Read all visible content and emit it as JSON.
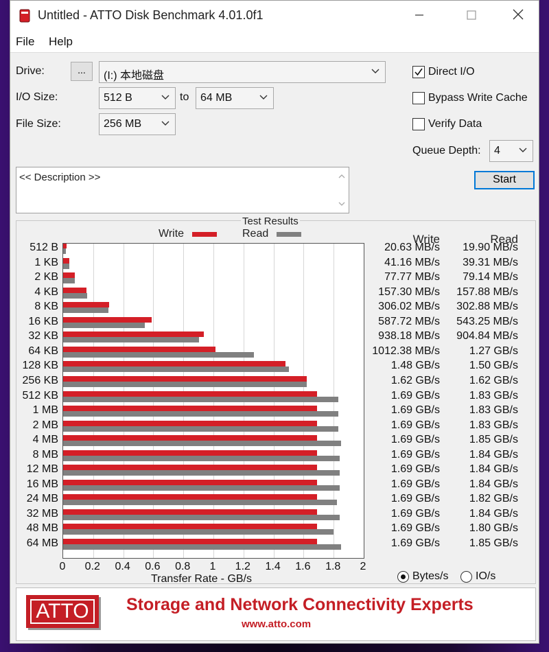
{
  "window": {
    "title": "Untitled - ATTO Disk Benchmark 4.01.0f1"
  },
  "menu": {
    "file": "File",
    "help": "Help"
  },
  "settings": {
    "drive_label": "Drive:",
    "browse_label": "...",
    "drive_value": "(I:) 本地磁盘",
    "io_size_label": "I/O Size:",
    "io_min": "512 B",
    "to_label": "to",
    "io_max": "64 MB",
    "file_size_label": "File Size:",
    "file_size": "256 MB",
    "direct_io_label": "Direct I/O",
    "direct_io_checked": true,
    "bypass_label": "Bypass Write Cache",
    "bypass_checked": false,
    "verify_label": "Verify Data",
    "verify_checked": false,
    "queue_label": "Queue Depth:",
    "queue_value": "4",
    "start_label": "Start",
    "description": "<< Description >>"
  },
  "results": {
    "title": "Test Results",
    "legend_write": "Write",
    "legend_read": "Read",
    "col_write": "Write",
    "col_read": "Read",
    "write_color": "#d41f27",
    "read_color": "#808080",
    "bytes_label": "Bytes/s",
    "io_label": "IO/s",
    "units_selected": "Bytes/s"
  },
  "chart_data": {
    "type": "bar",
    "orientation": "horizontal",
    "title": "Test Results",
    "xlabel": "Transfer Rate - GB/s",
    "xlim": [
      0,
      2
    ],
    "xticks": [
      "0",
      "0.2",
      "0.4",
      "0.6",
      "0.8",
      "1",
      "1.2",
      "1.4",
      "1.6",
      "1.8",
      "2"
    ],
    "categories": [
      "512 B",
      "1 KB",
      "2 KB",
      "4 KB",
      "8 KB",
      "16 KB",
      "32 KB",
      "64 KB",
      "128 KB",
      "256 KB",
      "512 KB",
      "1 MB",
      "2 MB",
      "4 MB",
      "8 MB",
      "12 MB",
      "16 MB",
      "24 MB",
      "32 MB",
      "48 MB",
      "64 MB"
    ],
    "series": [
      {
        "name": "Write",
        "values": [
          0.0206,
          0.0412,
          0.0778,
          0.1573,
          0.306,
          0.5877,
          0.9382,
          1.0124,
          1.48,
          1.62,
          1.69,
          1.69,
          1.69,
          1.69,
          1.69,
          1.69,
          1.69,
          1.69,
          1.69,
          1.69,
          1.69
        ],
        "labels": [
          "20.63 MB/s",
          "41.16 MB/s",
          "77.77 MB/s",
          "157.30 MB/s",
          "306.02 MB/s",
          "587.72 MB/s",
          "938.18 MB/s",
          "1012.38 MB/s",
          "1.48 GB/s",
          "1.62 GB/s",
          "1.69 GB/s",
          "1.69 GB/s",
          "1.69 GB/s",
          "1.69 GB/s",
          "1.69 GB/s",
          "1.69 GB/s",
          "1.69 GB/s",
          "1.69 GB/s",
          "1.69 GB/s",
          "1.69 GB/s",
          "1.69 GB/s"
        ]
      },
      {
        "name": "Read",
        "values": [
          0.0199,
          0.0393,
          0.0791,
          0.1579,
          0.3028,
          0.5433,
          0.9048,
          1.27,
          1.5,
          1.62,
          1.83,
          1.83,
          1.83,
          1.85,
          1.84,
          1.84,
          1.84,
          1.82,
          1.84,
          1.8,
          1.85
        ],
        "labels": [
          "19.90 MB/s",
          "39.31 MB/s",
          "79.14 MB/s",
          "157.88 MB/s",
          "302.88 MB/s",
          "543.25 MB/s",
          "904.84 MB/s",
          "1.27 GB/s",
          "1.50 GB/s",
          "1.62 GB/s",
          "1.83 GB/s",
          "1.83 GB/s",
          "1.83 GB/s",
          "1.85 GB/s",
          "1.84 GB/s",
          "1.84 GB/s",
          "1.84 GB/s",
          "1.82 GB/s",
          "1.84 GB/s",
          "1.80 GB/s",
          "1.85 GB/s"
        ]
      }
    ]
  },
  "banner": {
    "logo": "ATTO",
    "tagline": "Storage and Network Connectivity Experts",
    "url": "www.atto.com"
  }
}
